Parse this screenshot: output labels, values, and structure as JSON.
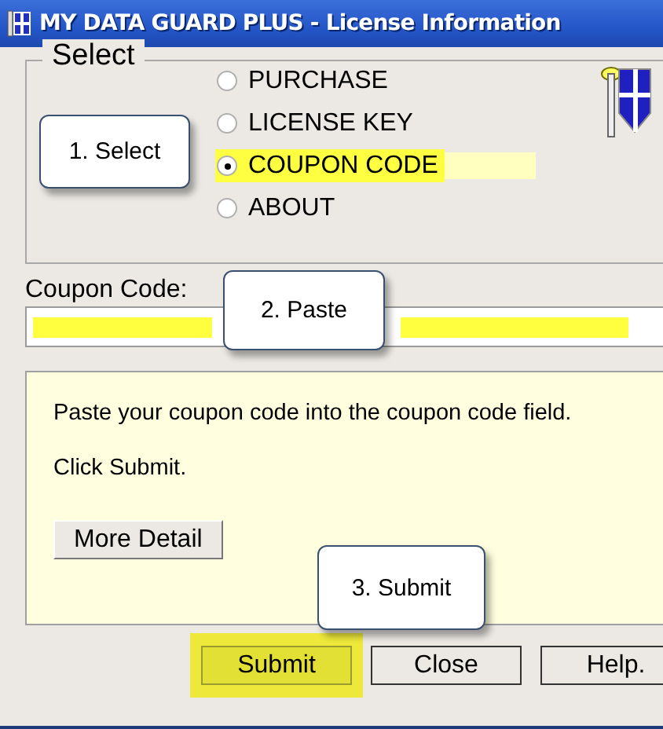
{
  "window": {
    "title": "MY DATA GUARD PLUS - License Information"
  },
  "select_group": {
    "title": "Select",
    "options": [
      {
        "label": "PURCHASE",
        "selected": false,
        "highlighted": false
      },
      {
        "label": "LICENSE KEY",
        "selected": false,
        "highlighted": false
      },
      {
        "label": "COUPON CODE",
        "selected": true,
        "highlighted": true
      },
      {
        "label": "ABOUT",
        "selected": false,
        "highlighted": false
      }
    ]
  },
  "coupon_field": {
    "label": "Coupon Code:",
    "masked": true
  },
  "info_panel": {
    "lines": [
      "Paste your coupon code into the coupon code field.",
      "Click Submit."
    ],
    "button": "More Detail"
  },
  "buttons": [
    {
      "label": "Submit",
      "highlighted": true
    },
    {
      "label": "Close",
      "highlighted": false
    },
    {
      "label": "Help.",
      "highlighted": false
    }
  ],
  "callouts": [
    "1. Select",
    "2. Paste",
    "3. Submit"
  ]
}
